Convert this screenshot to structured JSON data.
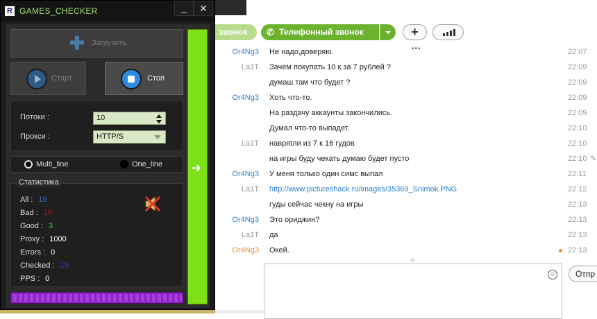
{
  "app": {
    "title": "GAMES_CHECKER",
    "logo_letter": "R",
    "minimize": "_",
    "close": "✕"
  },
  "buttons": {
    "load": "Загрузить",
    "start": "Старт",
    "stop": "Стоп"
  },
  "settings": {
    "threads_label": "Потоки :",
    "threads_value": "10",
    "proxy_label": "Прокси :",
    "proxy_value": "HTTP/S"
  },
  "modes": {
    "multi": "Multi_line",
    "one": "One_line",
    "selected": "Multi_line"
  },
  "stats": {
    "title": "Статистика",
    "all_label": "All :",
    "all_value": "19",
    "bad_label": "Bad :",
    "bad_value": "16",
    "good_label": "Good :",
    "good_value": "3",
    "proxy_label": "Proxy :",
    "proxy_value": "1000",
    "errors_label": "Errors :",
    "errors_value": "0",
    "checked_label": "Checked :",
    "checked_value": "19",
    "pps_label": "PPS :",
    "pps_value": "0"
  },
  "icons": {
    "mute": "speaker-muted-icon",
    "arrow": "arrow-right-icon",
    "plus": "plus-icon"
  },
  "colors": {
    "accent_green": "#7ee017",
    "progress_purple": "#8c22c2",
    "call_green": "#6cb22e"
  },
  "skype": {
    "call_partial": "звонок",
    "call_label": "Телефонный звонок",
    "add_label": "+",
    "send_label": "Отпр",
    "messages": [
      {
        "author": "Or4Ng3",
        "author_type": "or",
        "text": "Не надо,доверяю.",
        "time": "22:07"
      },
      {
        "author": "La1T",
        "author_type": "la",
        "text": "Зачем покупать 10 к за 7 рублей ?",
        "time": "22:09"
      },
      {
        "author": "",
        "author_type": "la",
        "text": "думаш там что будет ?",
        "time": "22:09"
      },
      {
        "author": "Or4Ng3",
        "author_type": "or",
        "text": "Хоть что-то.",
        "time": "22:09"
      },
      {
        "author": "",
        "author_type": "or",
        "text": "На раздачу аккаунты закончились.",
        "time": "22:09"
      },
      {
        "author": "",
        "author_type": "or",
        "text": "Думал что-то выпадет.",
        "time": "22:10"
      },
      {
        "author": "La1T",
        "author_type": "la",
        "text": "навряtли из 7 к 16 гудов",
        "time": "22:10"
      },
      {
        "author": "",
        "author_type": "la",
        "text": "на игры буду чекать думаю будет пусто",
        "time": "22:10"
      },
      {
        "author": "Or4Ng3",
        "author_type": "or",
        "text": "У меня только один симс выпал",
        "time": "22:11"
      },
      {
        "author": "La1T",
        "author_type": "la",
        "text": "http://www.pictureshack.ru/images/35369_Snimok.PNG",
        "time": "22:12"
      },
      {
        "author": "",
        "author_type": "la",
        "text": "гуды сейчас чекну на игры",
        "time": "22:13"
      },
      {
        "author": "Or4Ng3",
        "author_type": "or",
        "text": "Это ориджин?",
        "time": "22:13"
      },
      {
        "author": "La1T",
        "author_type": "la",
        "text": "да",
        "time": "22:13"
      },
      {
        "author": "Or4Ng3",
        "author_type": "or-new",
        "text": "Окей.",
        "time": "22:13"
      }
    ]
  }
}
